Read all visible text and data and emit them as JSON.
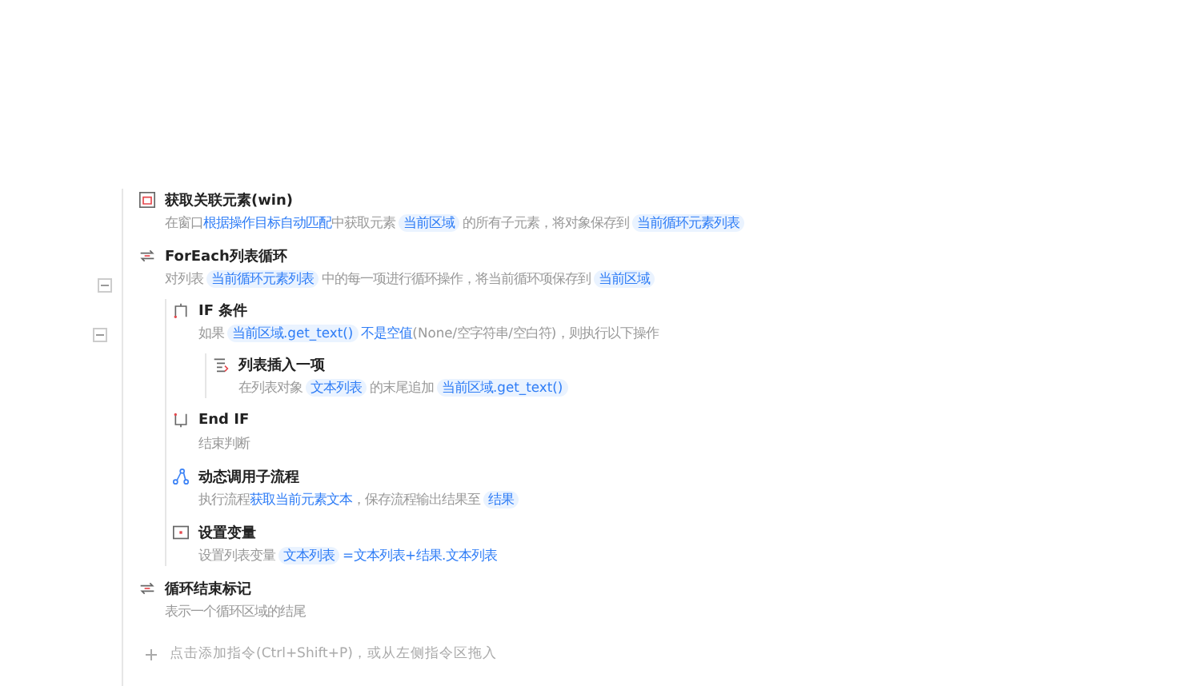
{
  "steps": [
    {
      "kind": "element",
      "title": "获取关联元素(win)",
      "description": [
        {
          "kind": "plain",
          "text": "在窗口"
        },
        {
          "kind": "link",
          "text": "根据操作目标自动匹配"
        },
        {
          "kind": "plain",
          "text": "中获取元素"
        },
        {
          "kind": "chip",
          "text": "当前区域"
        },
        {
          "kind": "plain",
          "text": "的所有子元素，将对象保存到"
        },
        {
          "kind": "chip",
          "text": "当前循环元素列表"
        }
      ]
    },
    {
      "kind": "loop",
      "title": "ForEach列表循环",
      "expanded": true,
      "description": [
        {
          "kind": "plain",
          "text": "对列表"
        },
        {
          "kind": "chip",
          "text": "当前循环元素列表"
        },
        {
          "kind": "plain",
          "text": "中的每一项进行循环操作，将当前循环项保存到"
        },
        {
          "kind": "chip",
          "text": "当前区域"
        }
      ],
      "children": [
        {
          "kind": "if",
          "title": "IF 条件",
          "expanded": true,
          "description": [
            {
              "kind": "plain",
              "text": "如果"
            },
            {
              "kind": "chip",
              "text": "当前区域.get_text()"
            },
            {
              "kind": "link",
              "text": "不是空值"
            },
            {
              "kind": "plain",
              "text": "(None/空字符串/空白符)，则执行以下操作"
            }
          ],
          "children": [
            {
              "kind": "list",
              "title": "列表插入一项",
              "description": [
                {
                  "kind": "plain",
                  "text": "在列表对象"
                },
                {
                  "kind": "chip",
                  "text": "文本列表"
                },
                {
                  "kind": "plain",
                  "text": "的末尾追加"
                },
                {
                  "kind": "chip",
                  "text": "当前区域.get_text()"
                }
              ]
            }
          ]
        },
        {
          "kind": "endif",
          "title": "End IF",
          "description": [
            {
              "kind": "plain",
              "text": "结束判断"
            }
          ]
        },
        {
          "kind": "subflow",
          "title": "动态调用子流程",
          "description": [
            {
              "kind": "plain",
              "text": "执行流程"
            },
            {
              "kind": "link",
              "text": "获取当前元素文本"
            },
            {
              "kind": "plain",
              "text": "，保存流程输出结果至"
            },
            {
              "kind": "chip",
              "text": "结果"
            }
          ]
        },
        {
          "kind": "variable",
          "title": "设置变量",
          "description": [
            {
              "kind": "plain",
              "text": "设置列表变量"
            },
            {
              "kind": "chip",
              "text": "文本列表"
            },
            {
              "kind": "link",
              "text": "=文本列表+结果.文本列表"
            }
          ]
        }
      ]
    },
    {
      "kind": "loop-end",
      "title": "循环结束标记",
      "description": [
        {
          "kind": "plain",
          "text": "表示一个循环区域的结尾"
        }
      ]
    }
  ],
  "add_hint": "点击添加指令(Ctrl+Shift+P)，或从左侧指令区拖入"
}
